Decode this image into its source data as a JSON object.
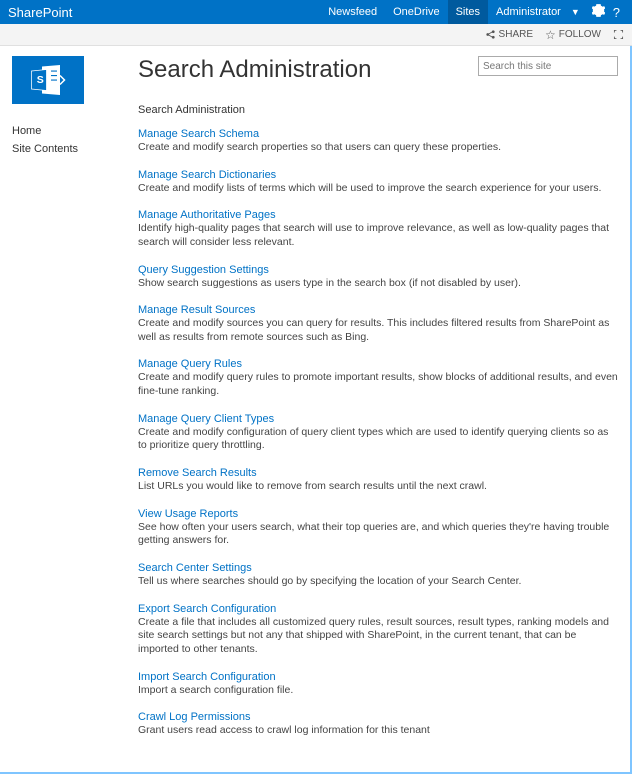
{
  "header": {
    "brand": "SharePoint",
    "links": [
      "Newsfeed",
      "OneDrive",
      "Sites"
    ],
    "active_link_index": 2,
    "admin_label": "Administrator"
  },
  "subbar": {
    "share": "SHARE",
    "follow": "FOLLOW"
  },
  "leftnav": {
    "items": [
      {
        "label": "Home"
      },
      {
        "label": "Site Contents"
      }
    ]
  },
  "search": {
    "placeholder": "Search this site"
  },
  "page_title": "Search Administration",
  "breadcrumb": "Search Administration",
  "sections": [
    {
      "title": "Manage Search Schema",
      "body": "Create and modify search properties so that users can query these properties."
    },
    {
      "title": "Manage Search Dictionaries",
      "body": "Create and modify lists of terms which will be used to improve the search experience for your users."
    },
    {
      "title": "Manage Authoritative Pages",
      "body": "Identify high-quality pages that search will use to improve relevance, as well as low-quality pages that search will consider less relevant."
    },
    {
      "title": "Query Suggestion Settings",
      "body": "Show search suggestions as users type in the search box (if not disabled by user)."
    },
    {
      "title": "Manage Result Sources",
      "body": "Create and modify sources you can query for results. This includes filtered results from SharePoint as well as results from remote sources such as Bing."
    },
    {
      "title": "Manage Query Rules",
      "body": "Create and modify query rules to promote important results, show blocks of additional results, and even fine-tune ranking."
    },
    {
      "title": "Manage Query Client Types",
      "body": "Create and modify configuration of query client types which are used to identify querying clients so as to prioritize query throttling."
    },
    {
      "title": "Remove Search Results",
      "body": "List URLs you would like to remove from search results until the next crawl."
    },
    {
      "title": "View Usage Reports",
      "body": "See how often your users search, what their top queries are, and which queries they're having trouble getting answers for."
    },
    {
      "title": "Search Center Settings",
      "body": "Tell us where searches should go by specifying the location of your Search Center."
    },
    {
      "title": "Export Search Configuration",
      "body": "Create a file that includes all customized query rules, result sources, result types, ranking models and site search settings but not any that shipped with SharePoint, in the current tenant, that can be imported to other tenants."
    },
    {
      "title": "Import Search Configuration",
      "body": "Import a search configuration file."
    },
    {
      "title": "Crawl Log Permissions",
      "body": "Grant users read access to crawl log information for this tenant"
    }
  ]
}
